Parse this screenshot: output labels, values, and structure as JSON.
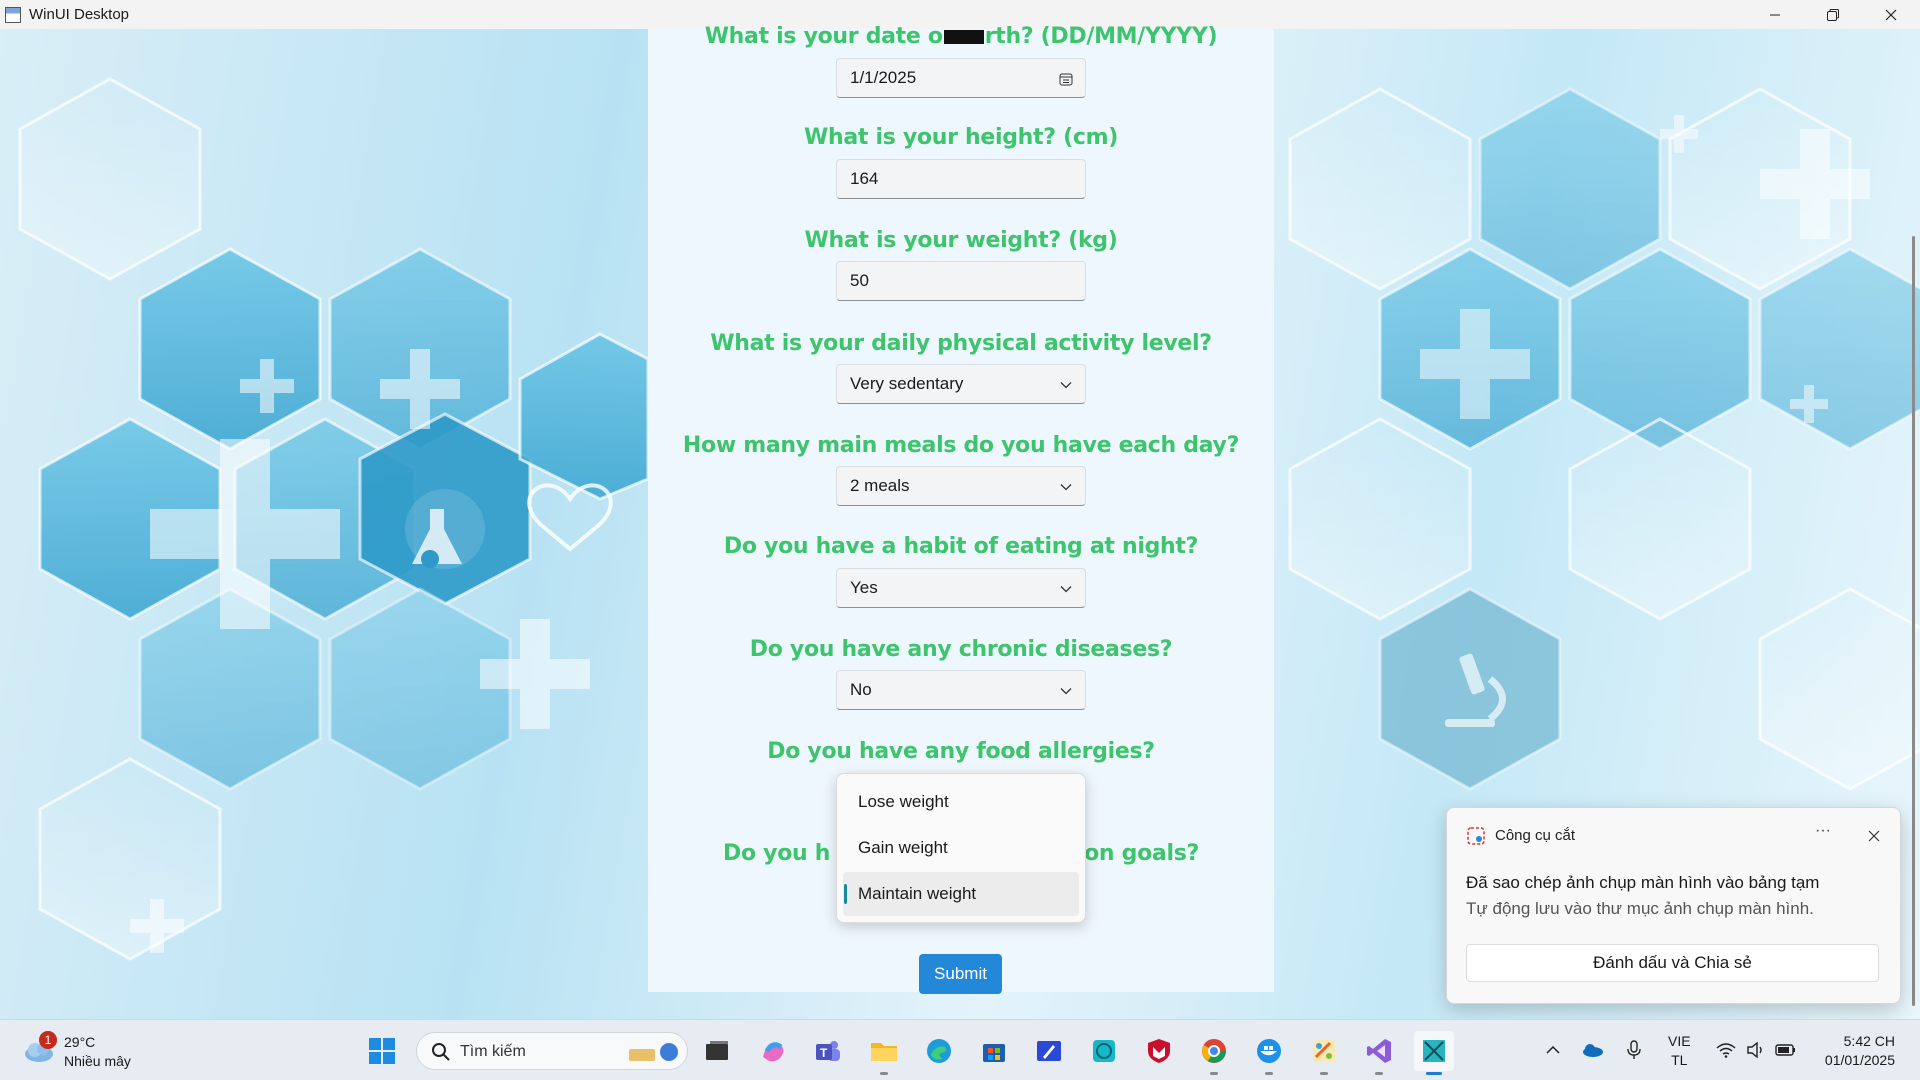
{
  "window": {
    "title": "WinUI Desktop"
  },
  "form": {
    "q_dob_before": "What is your date o",
    "q_dob_after": "rth? (DD/MM/YYYY)",
    "dob_value": "1/1/2025",
    "q_height": "What is your height? (cm)",
    "height_value": "164",
    "q_weight": "What is your weight? (kg)",
    "weight_value": "50",
    "q_activity": "What is your daily physical activity level?",
    "activity_value": "Very sedentary",
    "q_meals": "How many main meals do you have each day?",
    "meals_value": "2 meals",
    "q_night": "Do you have a habit of eating at night?",
    "night_value": "Yes",
    "q_chronic": "Do you have any chronic diseases?",
    "chronic_value": "No",
    "q_allergies": "Do you have any food allergies?",
    "q_goals_left": "Do you h",
    "q_goals_right": "on goals?",
    "goal_options": [
      "Lose weight",
      "Gain weight",
      "Maintain weight"
    ],
    "goal_selected_index": 2,
    "submit_label": "Submit"
  },
  "toast": {
    "app_name": "Công cụ cắt",
    "more": "···",
    "line1": "Đã sao chép ảnh chụp màn hình vào bảng tạm",
    "line2": "Tự động lưu vào thư mục ảnh chụp màn hình.",
    "action_label": "Đánh dấu và Chia sẻ"
  },
  "taskbar": {
    "weather_badge": "1",
    "weather_temp": "29°C",
    "weather_desc": "Nhiều mây",
    "search_placeholder": "Tìm kiếm",
    "lang_line1": "VIE",
    "lang_line2": "TL",
    "time": "5:42 CH",
    "date": "01/01/2025"
  },
  "colors": {
    "question_green": "#3ec46d",
    "accent_blue": "#2388d8",
    "selection_teal": "#1d8a98"
  }
}
